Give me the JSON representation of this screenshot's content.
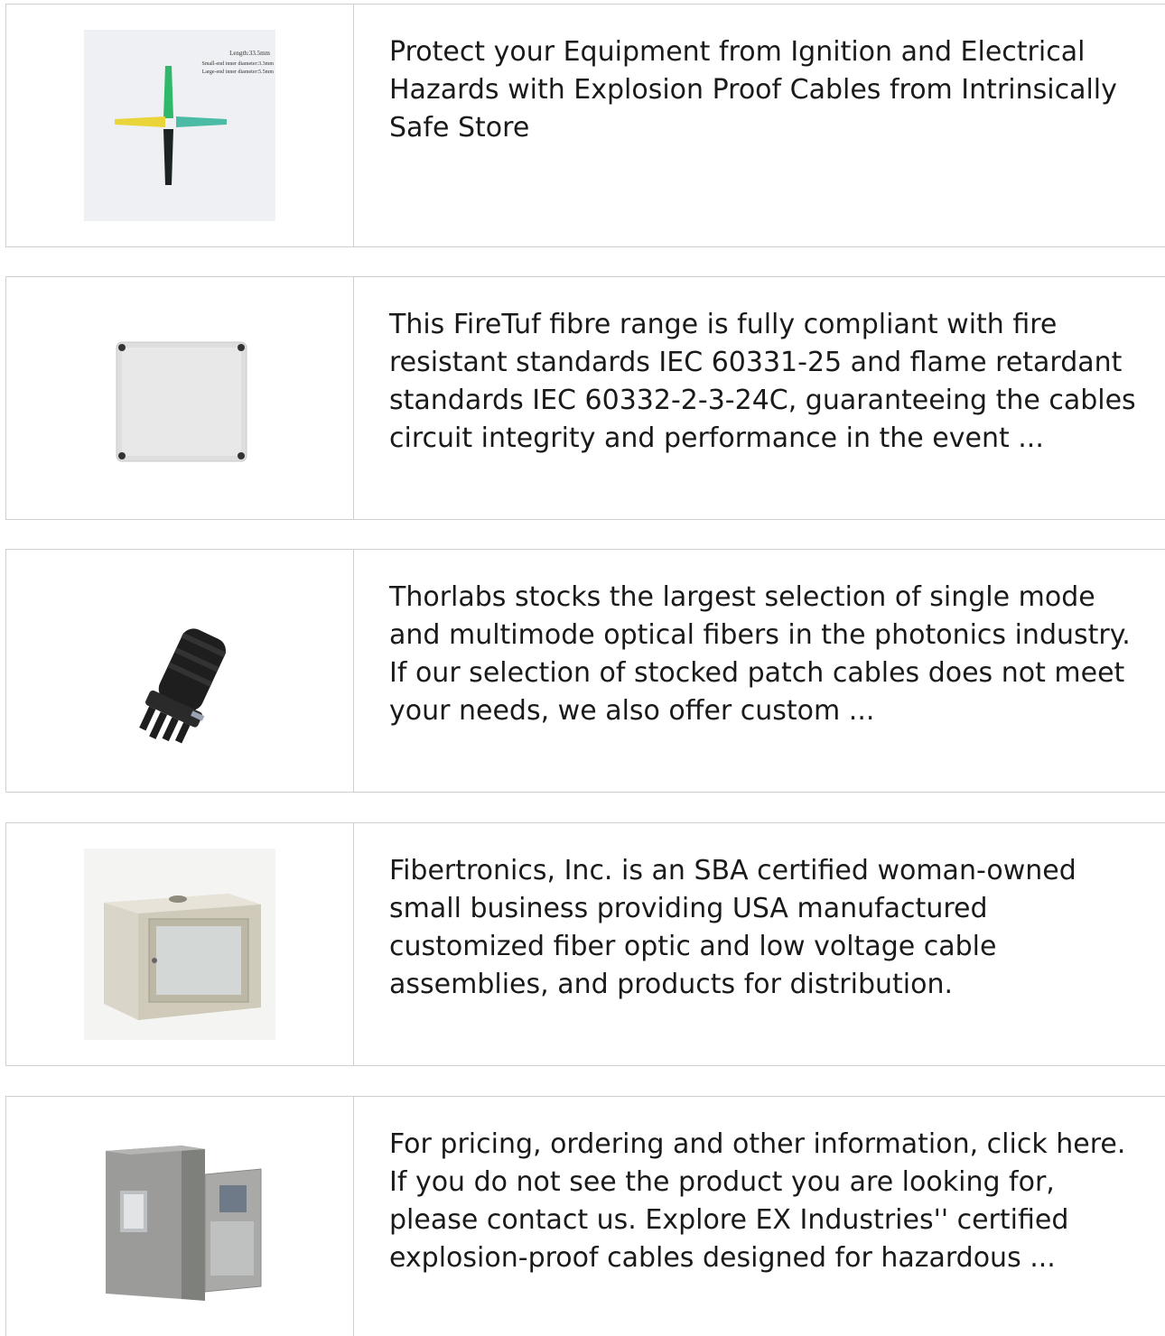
{
  "results": [
    {
      "thumb_icon": "cable-boot-connectors-image",
      "thumb_labels": [
        "Length:33.5mm",
        "Small-end inner diameter:3.3mm",
        "Large-end inner diameter:5.5mm"
      ],
      "description": "Protect your Equipment from Ignition and Electrical Hazards with Explosion Proof Cables from Intrinsically Safe Store"
    },
    {
      "thumb_icon": "junction-box-image",
      "description": "This FireTuf fibre range is fully compliant with fire resistant standards IEC 60331-25 and flame retardant standards IEC 60332-2-3-24C, guaranteeing the cables circuit integrity and performance in the event ..."
    },
    {
      "thumb_icon": "splice-closure-image",
      "description": "Thorlabs stocks the largest selection of single mode and multimode optical fibers in the photonics industry. If our selection of stocked patch cables does not meet your needs, we also offer custom ..."
    },
    {
      "thumb_icon": "wall-mount-cabinet-image",
      "description": "Fibertronics, Inc. is an SBA certified woman-owned small business providing USA manufactured customized fiber optic and low voltage cable assemblies, and products for distribution."
    },
    {
      "thumb_icon": "outdoor-cabinet-image",
      "description": "For pricing, ordering and other information, click here. If you do not see the product you are looking for, please contact us. Explore EX Industries'' certified explosion-proof cables designed for hazardous ..."
    }
  ],
  "colors": {
    "border": "#cfcfcf",
    "text": "#1a1a1a"
  }
}
